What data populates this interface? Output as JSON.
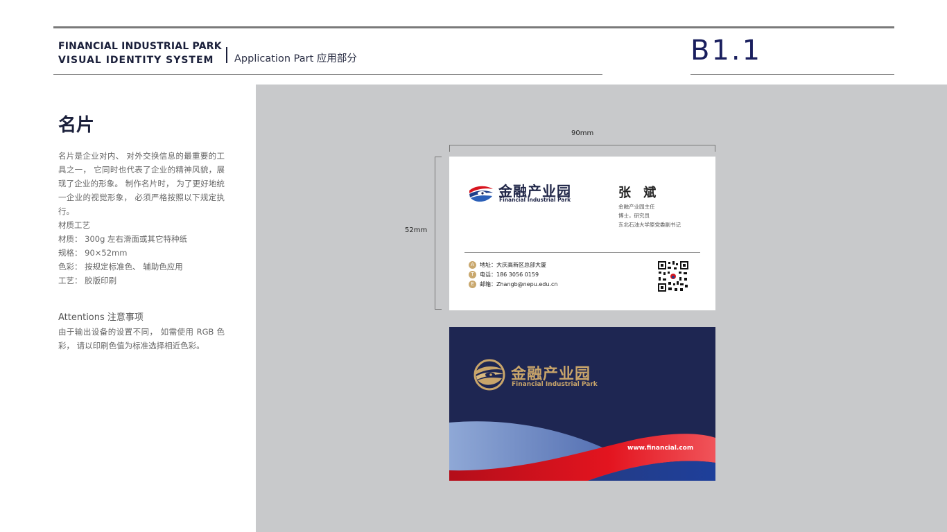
{
  "header": {
    "brand_line1": "FINANCIAL INDUSTRIAL PARK",
    "brand_line2": "VISUAL IDENTITY SYSTEM",
    "section_label": "Application Part 应用部分",
    "page_code": "B1.1"
  },
  "left": {
    "title": "名片",
    "description": "名片是企业对内、 对外交换信息的最重要的工具之一， 它同时也代表了企业的精神风貌，展现了企业的形象。 制作名片时， 为了更好地统一企业的视觉形象， 必须严格按照以下规定执行。",
    "specs": [
      "材质工艺",
      "材质： 300g 左右滑面或其它特种纸",
      "规格： 90×52mm",
      "色彩： 按规定标准色、 辅助色应用",
      "工艺： 胶版印刷"
    ],
    "attention_title": "Attentions 注意事项",
    "attention_text": "由于输出设备的设置不同， 如需使用 RGB 色彩， 请以印刷色值为标准选择相近色彩。"
  },
  "dimensions": {
    "width_label": "90mm",
    "height_label": "52mm"
  },
  "card_front": {
    "logo_cn": "金融产业园",
    "logo_en": "Financial Industrial Park",
    "name": "张 斌",
    "titles": [
      "金融产业园主任",
      "博士，研究员",
      "东北石油大学原党委副书记"
    ],
    "contacts": [
      {
        "icon": "A",
        "text": "地址：大庆高新区总部大厦"
      },
      {
        "icon": "T",
        "text": "电话：186 3056 0159"
      },
      {
        "icon": "E",
        "text": "邮箱：Zhangb@nepu.edu.cn"
      }
    ]
  },
  "card_back": {
    "logo_cn": "金融产业园",
    "logo_en": "Financial Industrial Park",
    "website": "www.financial.com"
  },
  "colors": {
    "navy": "#1e2652",
    "gold": "#c9a56a",
    "red": "#d8141e",
    "blue": "#1e3f8a",
    "panel_gray": "#c8c9cb"
  }
}
